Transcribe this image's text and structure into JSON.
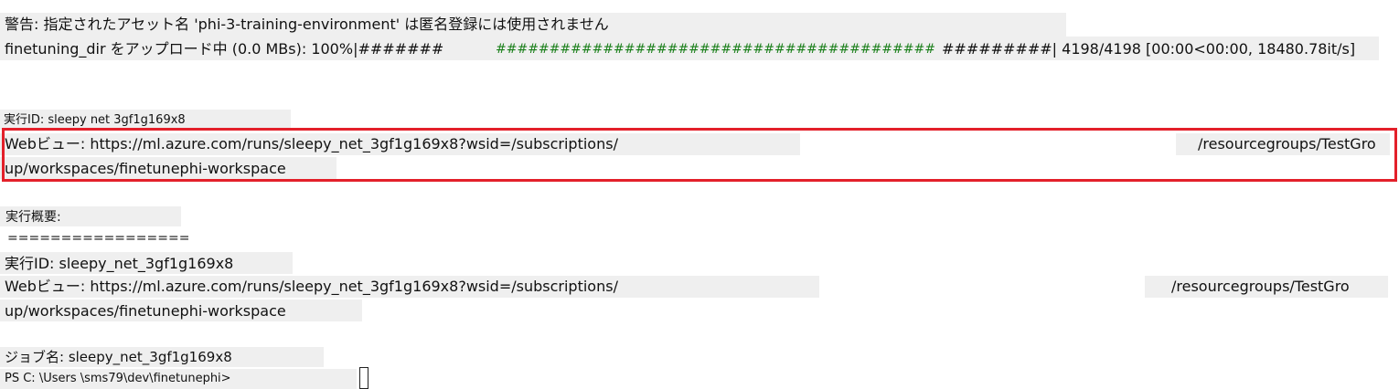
{
  "terminal": {
    "warning_line": "警告: 指定されたアセット名 'phi-3-training-environment' は匿名登録には使用されません",
    "upload": {
      "prefix": "finetuning_dir をアップロード中 (0.0 MBs): 100%|#######",
      "bar_middle": "#########################################",
      "bar_end": "#########| 4198/4198 [00:00<00:00, 18480.78it/s]",
      "percent": 100,
      "done": 4198,
      "total": 4198
    },
    "run_id_line": "実行ID: sleepy net 3gf1g169x8",
    "web_view_1": {
      "part1": "Webビュー: https://ml.azure.com/runs/sleepy_net_3gf1g169x8?wsid=/subscriptions/",
      "part2": "/resourcegroups/TestGro",
      "part3": "up/workspaces/finetunephi-workspace"
    },
    "summary_heading": "実行概要:",
    "summary_rule": "=================",
    "summary_run_id": "実行ID: sleepy_net_3gf1g169x8",
    "web_view_2": {
      "part1": "Webビュー: https://ml.azure.com/runs/sleepy_net_3gf1g169x8?wsid=/subscriptions/",
      "part2": "/resourcegroups/TestGro",
      "part3": "up/workspaces/finetunephi-workspace"
    },
    "job_name": "ジョブ名: sleepy_net_3gf1g169x8",
    "prompt": "PS C: \\Users \\sms79\\dev\\finetunephi>"
  },
  "colors": {
    "highlight_box": "#e3202a",
    "progress_green": "#1a7f1a",
    "line_background": "#efefef"
  }
}
